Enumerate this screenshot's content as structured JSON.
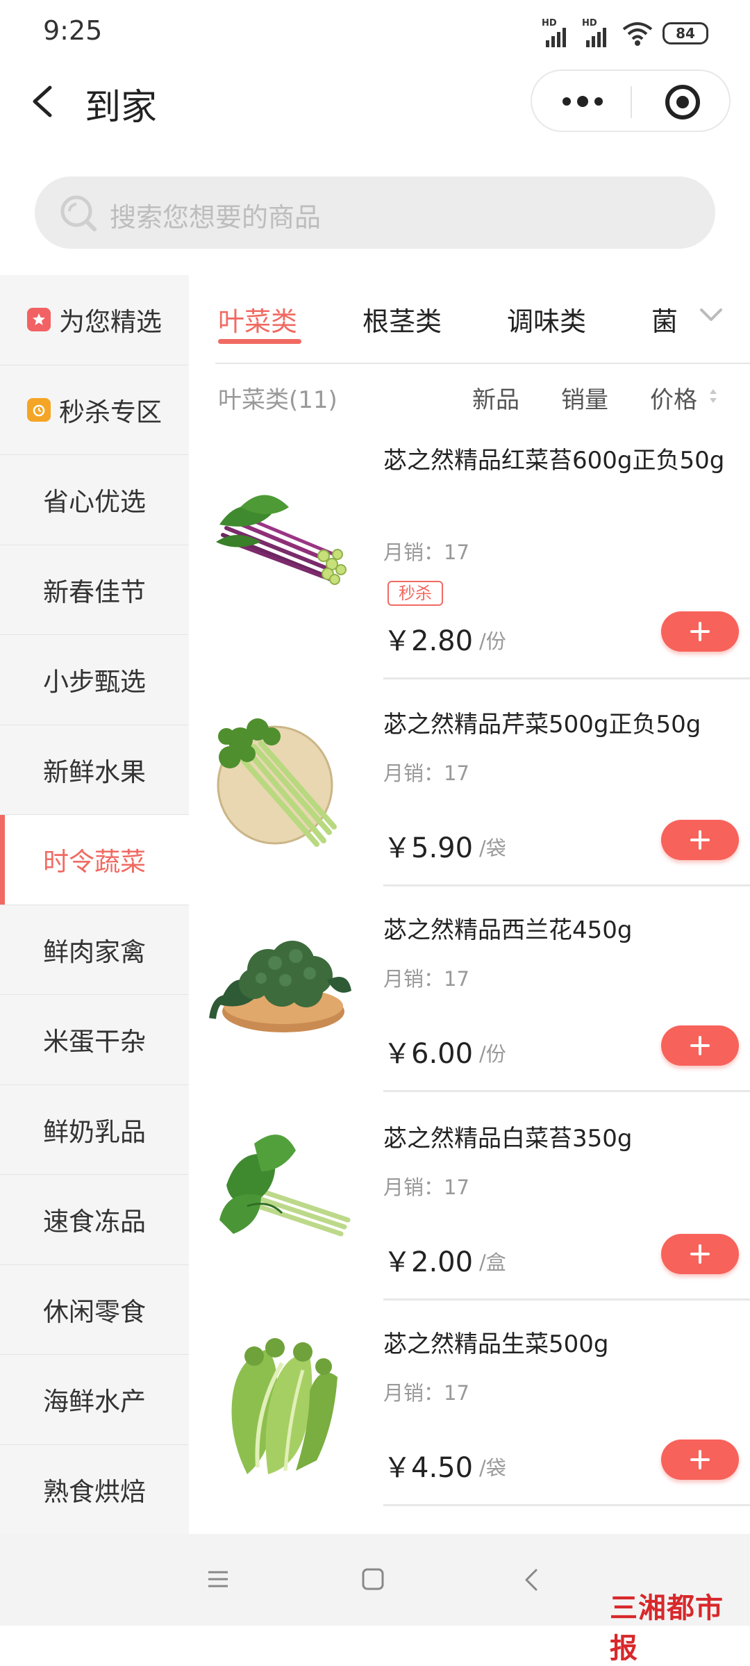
{
  "status_bar": {
    "time": "9:25",
    "signal1_label": "HD",
    "signal2_label": "HD",
    "battery": "84"
  },
  "nav": {
    "title": "到家"
  },
  "search": {
    "placeholder": "搜索您想要的商品"
  },
  "sidebar": {
    "items": [
      {
        "label": "为您精选",
        "icon": "star-badge-icon"
      },
      {
        "label": "秒杀专区",
        "icon": "clock-badge-icon"
      },
      {
        "label": "省心优选"
      },
      {
        "label": "新春佳节"
      },
      {
        "label": "小步甄选"
      },
      {
        "label": "新鲜水果"
      },
      {
        "label": "时令蔬菜",
        "active": true
      },
      {
        "label": "鲜肉家禽"
      },
      {
        "label": "米蛋干杂"
      },
      {
        "label": "鲜奶乳品"
      },
      {
        "label": "速食冻品"
      },
      {
        "label": "休闲零食"
      },
      {
        "label": "海鲜水产"
      },
      {
        "label": "熟食烘焙"
      }
    ]
  },
  "tabs": {
    "items": [
      "叶菜类",
      "根茎类",
      "调味类",
      "菌"
    ],
    "active_index": 0
  },
  "sort_bar": {
    "category_count": "叶菜类(11)",
    "new": "新品",
    "sales": "销量",
    "price": "价格"
  },
  "products": [
    {
      "name": "苾之然精品红菜苔600g正负50g",
      "sales": "月销：17",
      "badge": "秒杀",
      "price": "￥2.80",
      "unit": "/份"
    },
    {
      "name": "苾之然精品芹菜500g正负50g",
      "sales": "月销：17",
      "price": "￥5.90",
      "unit": "/袋"
    },
    {
      "name": "苾之然精品西兰花450g",
      "sales": "月销：17",
      "price": "￥6.00",
      "unit": "/份"
    },
    {
      "name": "苾之然精品白菜苔350g",
      "sales": "月销：17",
      "price": "￥2.00",
      "unit": "/盒"
    },
    {
      "name": "苾之然精品生菜500g",
      "sales": "月销：17",
      "price": "￥4.50",
      "unit": "/袋"
    }
  ],
  "watermark": "三湘都市报",
  "colors": {
    "accent": "#f06a62",
    "add_button": "#f7625b",
    "sidebar_bg": "#f5f5f5"
  }
}
